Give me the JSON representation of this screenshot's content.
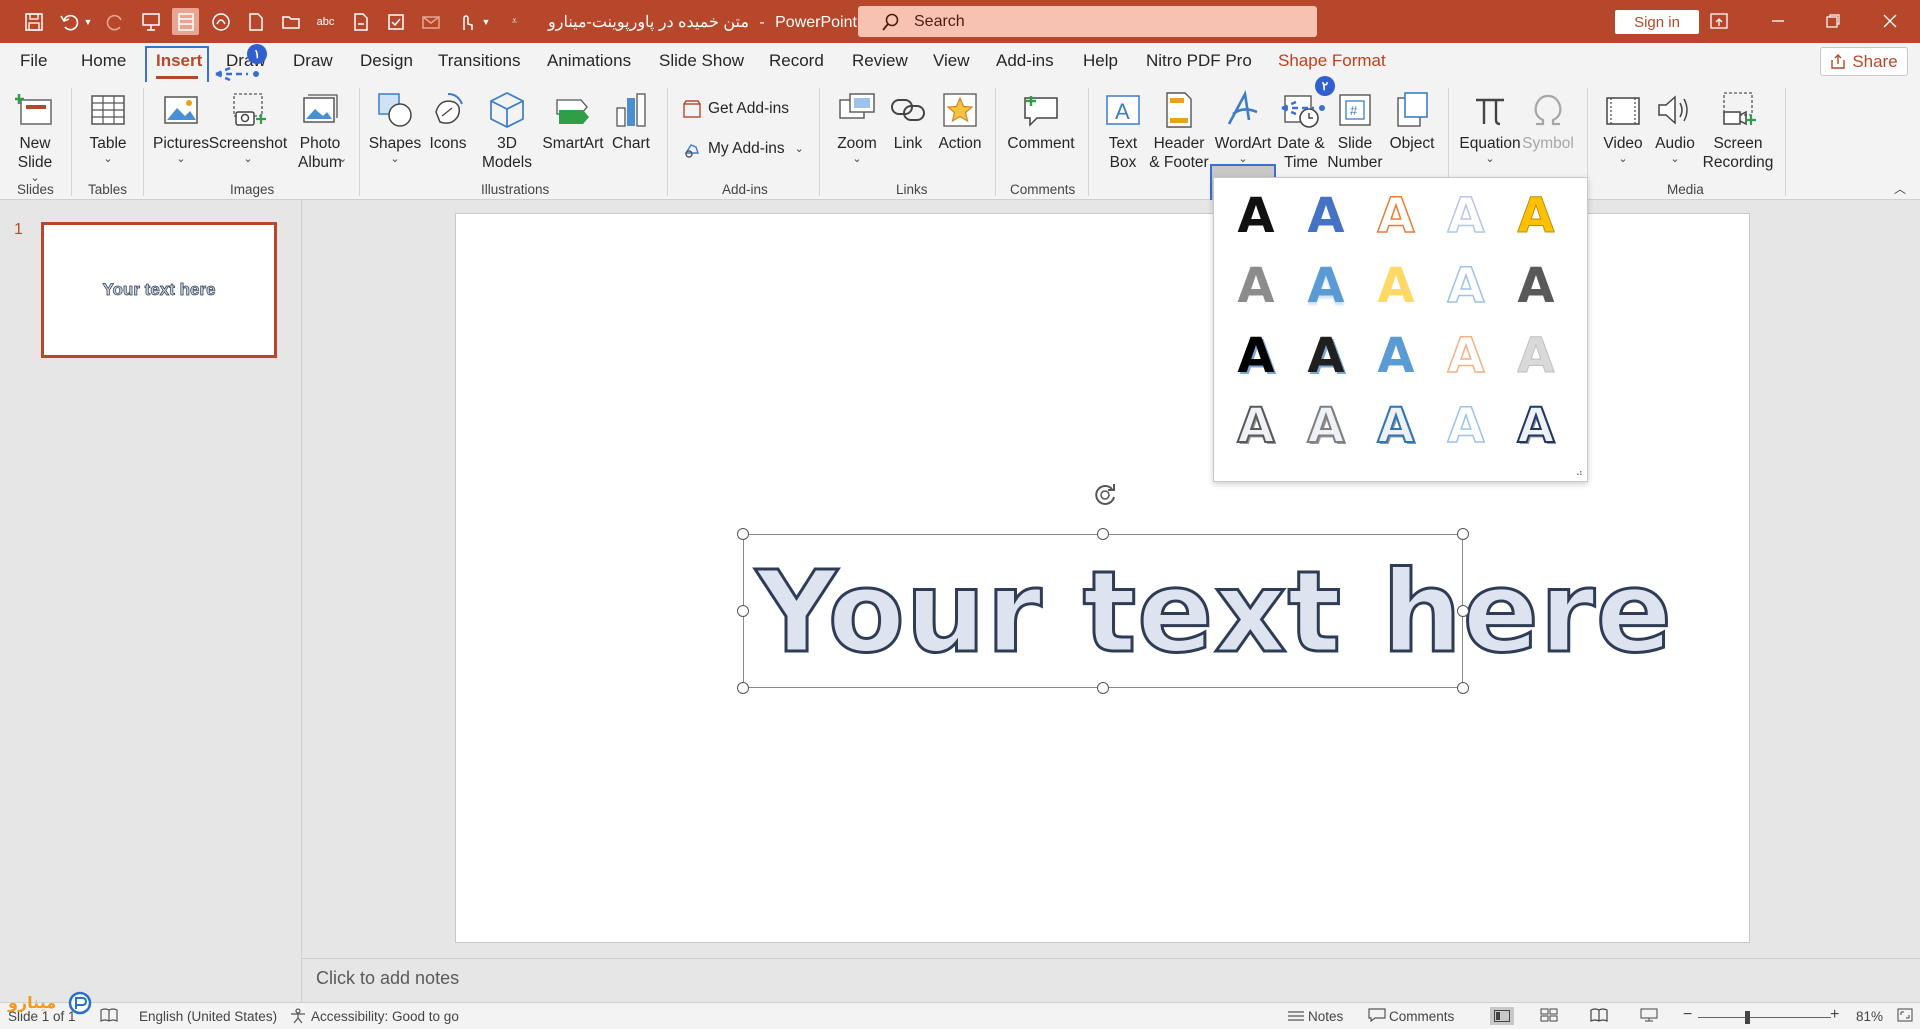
{
  "titlebar": {
    "doc_title": "متن خمیده در پاورپوینت-مینارو",
    "separator": "-",
    "app_name": "PowerPoint",
    "search_placeholder": "Search",
    "signin_label": "Sign in",
    "quick_access_icons": [
      "save-icon",
      "undo-icon",
      "undo-dropdown-icon",
      "redo-icon",
      "present-icon",
      "layout-icon",
      "draw-icon",
      "new-file-icon",
      "open-folder-icon",
      "spelling-icon",
      "pdf-icon",
      "check-icon",
      "email-icon",
      "touch-mode-icon",
      "more-dropdown-icon",
      "customize-icon"
    ]
  },
  "tabs": [
    "File",
    "Home",
    "Insert",
    "Draw",
    "Design",
    "Transitions",
    "Animations",
    "Slide Show",
    "Record",
    "Review",
    "View",
    "Add-ins",
    "Help",
    "Nitro PDF Pro",
    "Shape Format"
  ],
  "active_tab": "Insert",
  "share_label": "Share",
  "annotations": {
    "badge1": "۱",
    "badge2": "۲"
  },
  "ribbon": {
    "new_slide": "New Slide",
    "table": "Table",
    "pictures": "Pictures",
    "screenshot": "Screenshot",
    "photo_album": "Photo Album",
    "shapes": "Shapes",
    "icons": "Icons",
    "models_3d": "3D Models",
    "smartart": "SmartArt",
    "chart": "Chart",
    "get_addins": "Get Add-ins",
    "my_addins": "My Add-ins",
    "zoom": "Zoom",
    "link": "Link",
    "action": "Action",
    "comment": "Comment",
    "text_box": "Text Box",
    "header_footer": "Header & Footer",
    "wordart": "WordArt",
    "date_time": "Date & Time",
    "slide_number": "Slide Number",
    "object": "Object",
    "equation": "Equation",
    "symbol": "Symbol",
    "video": "Video",
    "audio": "Audio",
    "screen_recording": "Screen Recording",
    "groups": {
      "slides": "Slides",
      "tables": "Tables",
      "images": "Images",
      "illustrations": "Illustrations",
      "addins": "Add-ins",
      "links": "Links",
      "comments": "Comments",
      "media": "Media"
    }
  },
  "wordart_gallery": [
    [
      "#111111",
      "#4472c4",
      "#ed7d31",
      "#b4c7e7",
      "#ffc000"
    ],
    [
      "#8c8c8c",
      "#5b9bd5",
      "#ffd966",
      "#9dc3e6",
      "#595959"
    ],
    [
      "#000000",
      "#1f1f1f",
      "#5b9bd5",
      "#f4b183",
      "#d9d9d9"
    ],
    [
      "#595959",
      "#7f7f7f",
      "#2e75b6",
      "#9dc3e6",
      "#203864"
    ]
  ],
  "thumbnail": {
    "number": "1",
    "text": "Your text here"
  },
  "slide": {
    "text": "Your text here"
  },
  "notes_placeholder": "Click to add notes",
  "status": {
    "slide_info": "Slide 1 of 1",
    "language": "English (United States)",
    "accessibility": "Accessibility: Good to go",
    "notes": "Notes",
    "comments": "Comments",
    "zoom_minus": "−",
    "zoom_plus": "+",
    "zoom_level": "81%"
  },
  "logo_text": "مینارو",
  "colors": {
    "accent": "#b7472a",
    "highlight": "#3b6fd4",
    "search_bg": "#f8c2b3"
  }
}
